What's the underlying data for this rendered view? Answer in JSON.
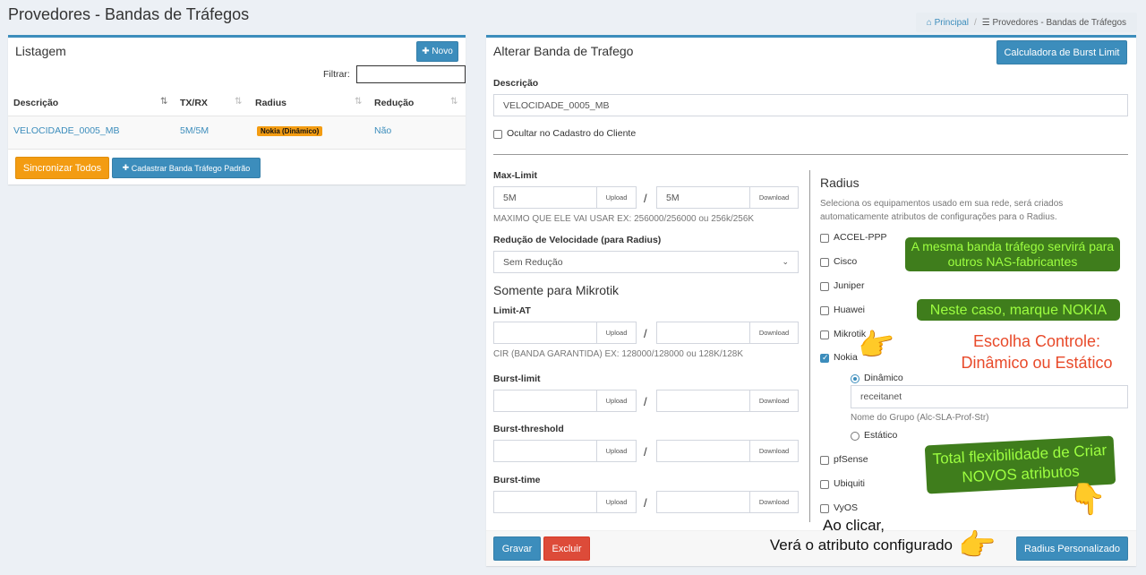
{
  "page_title": "Provedores - Bandas de Tráfegos",
  "breadcrumb": {
    "home_icon": "dashboard-icon",
    "home": "Principal",
    "current_icon": "list-icon",
    "current": "Provedores - Bandas de Tráfegos"
  },
  "listagem": {
    "title": "Listagem",
    "new_button": "Novo",
    "filter_label": "Filtrar:",
    "filter_value": "",
    "columns": [
      "Descrição",
      "TX/RX",
      "Radius",
      "Redução"
    ],
    "rows": [
      {
        "descricao": "VELOCIDADE_0005_MB",
        "txrx": "5M/5M",
        "radius": "Nokia (Dinâmico)",
        "reducao": "Não"
      }
    ],
    "sync_button": "Sincronizar Todos",
    "register_button": "Cadastrar Banda Tráfego Padrão"
  },
  "form": {
    "title": "Alterar Banda de Trafego",
    "burst_calc_button": "Calculadora de Burst Limit",
    "descricao_label": "Descrição",
    "descricao_value": "VELOCIDADE_0005_MB",
    "ocultar_label": "Ocultar no Cadastro do Cliente",
    "ocultar_checked": false,
    "upload_addon": "Upload",
    "download_addon": "Download",
    "max_limit": {
      "label": "Max-Limit",
      "upload": "5M",
      "download": "5M",
      "help": "MAXIMO QUE ELE VAI USAR EX: 256000/256000 ou 256k/256K"
    },
    "reducao": {
      "label": "Redução de Velocidade (para Radius)",
      "selected": "Sem Redução"
    },
    "mikrotik_heading": "Somente para Mikrotik",
    "limit_at": {
      "label": "Limit-AT",
      "upload": "",
      "download": "",
      "help": "CIR (BANDA GARANTIDA) EX: 128000/128000 ou 128K/128K"
    },
    "burst_limit": {
      "label": "Burst-limit",
      "upload": "",
      "download": ""
    },
    "burst_threshold": {
      "label": "Burst-threshold",
      "upload": "",
      "download": ""
    },
    "burst_time": {
      "label": "Burst-time",
      "upload": "",
      "download": ""
    },
    "save_button": "Gravar",
    "delete_button": "Excluir",
    "radius_custom_button": "Radius Personalizado"
  },
  "radius": {
    "heading": "Radius",
    "description": "Seleciona os equipamentos usado em sua rede, será criados automaticamente atributos de configurações para o Radius.",
    "vendors": [
      {
        "name": "ACCEL-PPP",
        "checked": false
      },
      {
        "name": "Cisco",
        "checked": false
      },
      {
        "name": "Juniper",
        "checked": false
      },
      {
        "name": "Huawei",
        "checked": false
      },
      {
        "name": "Mikrotik",
        "checked": false
      },
      {
        "name": "Nokia",
        "checked": true
      },
      {
        "name": "pfSense",
        "checked": false
      },
      {
        "name": "Ubiquiti",
        "checked": false
      },
      {
        "name": "VyOS",
        "checked": false
      }
    ],
    "nokia_dynamic": "Dinâmico",
    "nokia_group_value": "receitanet",
    "nokia_group_help": "Nome do Grupo (Alc-SLA-Prof-Str)",
    "nokia_static": "Estático"
  },
  "annotations": {
    "green1": "A mesma banda tráfego servirá para outros NAS-fabricantes",
    "green2": "Neste caso, marque NOKIA",
    "red": "Escolha Controle: Dinâmico ou Estático",
    "green3": "Total flexibilidade de Criar NOVOS atributos",
    "black1": "Ao clicar,",
    "black2": "Verá o atributo configurado",
    "hand_icon": "pointing-hand-icon"
  },
  "colors": {
    "primary": "#3c8dbc",
    "orange": "#f39c12",
    "red": "#dd4b39",
    "note_green_bg": "#3f7d1c",
    "note_green_text": "#9dff40",
    "note_red": "#e84a2a"
  }
}
